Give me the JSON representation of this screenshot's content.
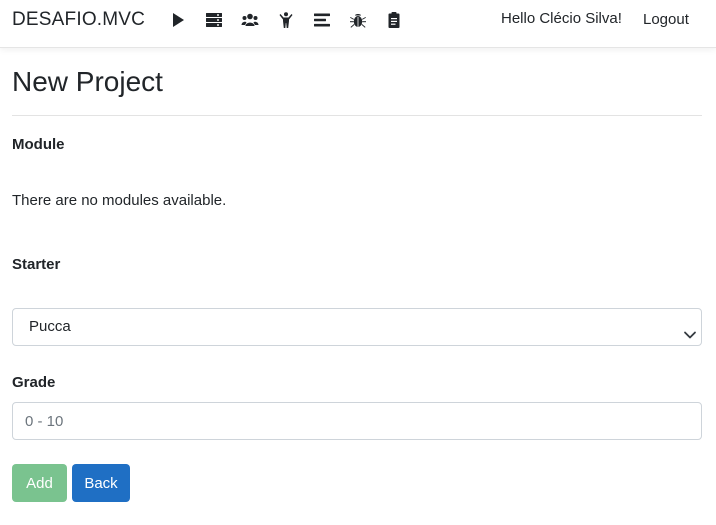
{
  "navbar": {
    "brand": "DESAFIO.MVC",
    "icons": [
      "play-icon",
      "server-icon",
      "users-icon",
      "child-icon",
      "list-icon",
      "bug-icon",
      "clipboard-icon"
    ],
    "greeting": "Hello Clécio Silva!",
    "logout_label": "Logout"
  },
  "page": {
    "title": "New Project"
  },
  "form": {
    "module_label": "Module",
    "module_empty_text": "There are no modules available.",
    "starter_label": "Starter",
    "starter_selected": "Pucca",
    "grade_label": "Grade",
    "grade_placeholder": "0 - 10",
    "add_label": "Add",
    "back_label": "Back"
  },
  "colors": {
    "add_button": "#7ac38f",
    "back_button": "#1f6fc4",
    "text": "#212529"
  }
}
